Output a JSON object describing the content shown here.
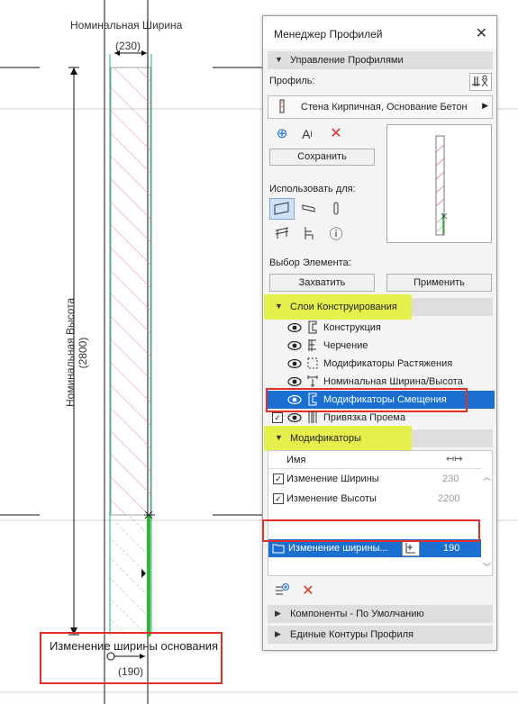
{
  "drawing": {
    "nominal_width_label": "Номинальная Ширина",
    "nominal_width_value": "(230)",
    "nominal_height_label": "Номинальная Высота",
    "nominal_height_value": "(2800)",
    "base_width_label": "Изменение ширины основания",
    "base_width_value": "(190)"
  },
  "panel": {
    "title": "Менеджер Профилей",
    "profile_management": "Управление Профилями",
    "profile_label": "Профиль:",
    "profile_value": "Стена Кирпичная, Основание Бетон",
    "save_button": "Сохранить",
    "use_for_label": "Использовать для:",
    "element_select_label": "Выбор Элемента:",
    "capture_button": "Захватить",
    "apply_button": "Применить",
    "construction_layers": "Слои Конструирования",
    "layers": [
      {
        "label": "Конструкция",
        "icon": "construction-icon"
      },
      {
        "label": "Черчение",
        "icon": "drafting-icon"
      },
      {
        "label": "Модификаторы Растяжения",
        "icon": "stretch-icon"
      },
      {
        "label": "Номинальная Ширина/Высота",
        "icon": "nominal-icon"
      },
      {
        "label": "Модификаторы Смещения",
        "icon": "offset-icon"
      },
      {
        "label": "Привязка Проема",
        "icon": "opening-icon"
      }
    ],
    "modifiers": "Модификаторы",
    "col_name": "Имя",
    "modifier_rows": [
      {
        "name": "Изменение Ширины",
        "value": "230"
      },
      {
        "name": "Изменение Высоты",
        "value": "2200"
      }
    ],
    "selected_modifier": {
      "name": "Изменение ширины...",
      "value": "190"
    },
    "components": "Компоненты - По Умолчанию",
    "unified_contours": "Единые Контуры Профиля"
  },
  "colors": {
    "selection": "#1a6fd1",
    "highlight": "#e5f04a",
    "annotation_red": "#e0302a",
    "hatch_red": "#f08a8a",
    "hatch_green": "#76c46a",
    "delete_red": "#e0302a"
  }
}
